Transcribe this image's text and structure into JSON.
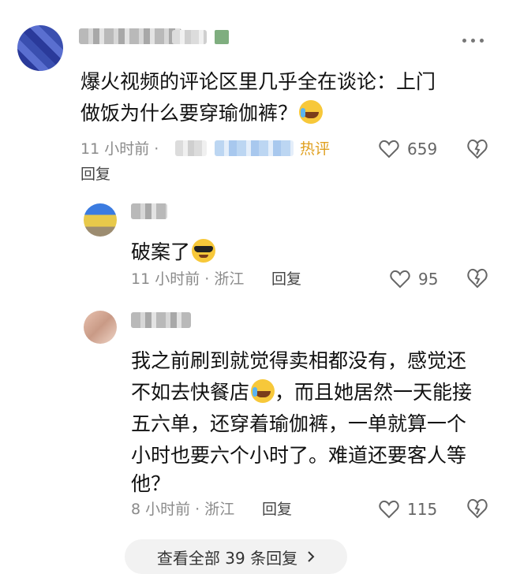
{
  "comment1": {
    "text_line1": "爆火视频的评论区里几乎全在谈论：上门",
    "text_line2": "做饭为什么要穿瑜伽裤？",
    "emoji": "cry-laugh-emoji",
    "time": "11 小时前 ·",
    "hot_badge": "热评",
    "likes": "659",
    "reply_label": "回复"
  },
  "reply1": {
    "text": "破案了",
    "emoji": "cool-sunglasses-emoji",
    "time": "11 小时前 · 浙江",
    "reply_label": "回复",
    "likes": "95"
  },
  "reply2": {
    "line1": "我之前刷到就觉得卖相都没有，感觉还",
    "line2a": "不如去快餐店",
    "line2b": "，而且她居然一天能接",
    "line3": "五六单，还穿着瑜伽裤，一单就算一个",
    "line4": "小时也要六个小时了。难道还要客人等",
    "line5": "他？",
    "emoji": "cry-laugh-emoji",
    "time": "8 小时前 · 浙江",
    "reply_label": "回复",
    "likes": "115"
  },
  "view_all": {
    "label": "查看全部 39 条回复",
    "icon": "chevron-right-icon"
  },
  "colors": {
    "hot": "#e0a020",
    "meta": "#8a8a8a"
  }
}
